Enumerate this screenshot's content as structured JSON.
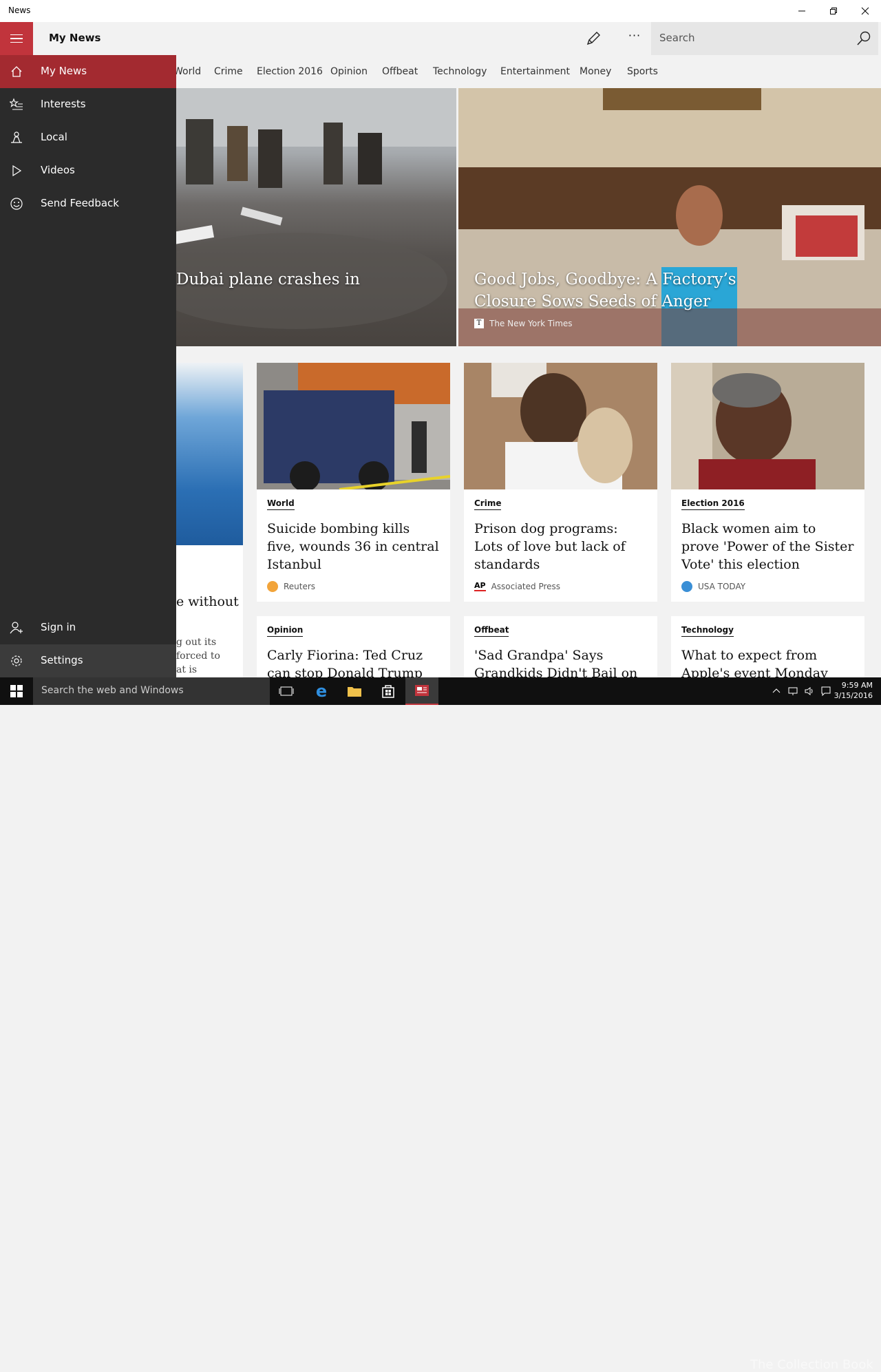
{
  "window": {
    "title": "News"
  },
  "appbar": {
    "title": "My News",
    "search_placeholder": "Search",
    "more_label": "···"
  },
  "categories": [
    "World",
    "Crime",
    "Election 2016",
    "Opinion",
    "Offbeat",
    "Technology",
    "Entertainment",
    "Money",
    "Sports"
  ],
  "heroes": [
    {
      "title": "Dubai plane crashes in",
      "source": ""
    },
    {
      "title_line1": "Good Jobs, Goodbye: A Factory’s",
      "title_line2": "Closure Sows Seeds of Anger",
      "source": "The New York Times"
    }
  ],
  "partial_card": {
    "title_fragment": "e without",
    "text_line1": "g out its",
    "text_line2": "forced to",
    "text_line3": "at is"
  },
  "cards": [
    {
      "category": "World",
      "title": "Suicide bombing kills five, wounds 36 in central Istanbul",
      "source": "Reuters"
    },
    {
      "category": "Crime",
      "title": "Prison dog programs: Lots of love but lack of standards",
      "source": "Associated Press"
    },
    {
      "category": "Election 2016",
      "title": "Black women aim to prove 'Power of the Sister Vote' this election",
      "source": "USA TODAY"
    },
    {
      "category": "Opinion",
      "title": "Carly Fiorina: Ted Cruz can stop Donald Trump and",
      "source": ""
    },
    {
      "category": "Offbeat",
      "title": "'Sad Grandpa' Says Grandkids Didn't Bail on",
      "source": ""
    },
    {
      "category": "Technology",
      "title": "What to expect from Apple's event Monday",
      "source": ""
    }
  ],
  "nav": {
    "items": [
      {
        "label": "My News",
        "icon": "home-icon"
      },
      {
        "label": "Interests",
        "icon": "star-list-icon"
      },
      {
        "label": "Local",
        "icon": "local-person-icon"
      },
      {
        "label": "Videos",
        "icon": "play-icon"
      },
      {
        "label": "Send Feedback",
        "icon": "smiley-icon"
      }
    ],
    "bottom": [
      {
        "label": "Sign in",
        "icon": "person-add-icon"
      },
      {
        "label": "Settings",
        "icon": "gear-icon"
      }
    ]
  },
  "taskbar": {
    "search_text": "Search the web and Windows",
    "time": "9:59 AM",
    "date": "3/15/2016",
    "watermark": "The Collection Book"
  },
  "colors": {
    "accent": "#c1343c",
    "nav_bg": "#2b2b2b",
    "nav_active": "#a32a30"
  }
}
